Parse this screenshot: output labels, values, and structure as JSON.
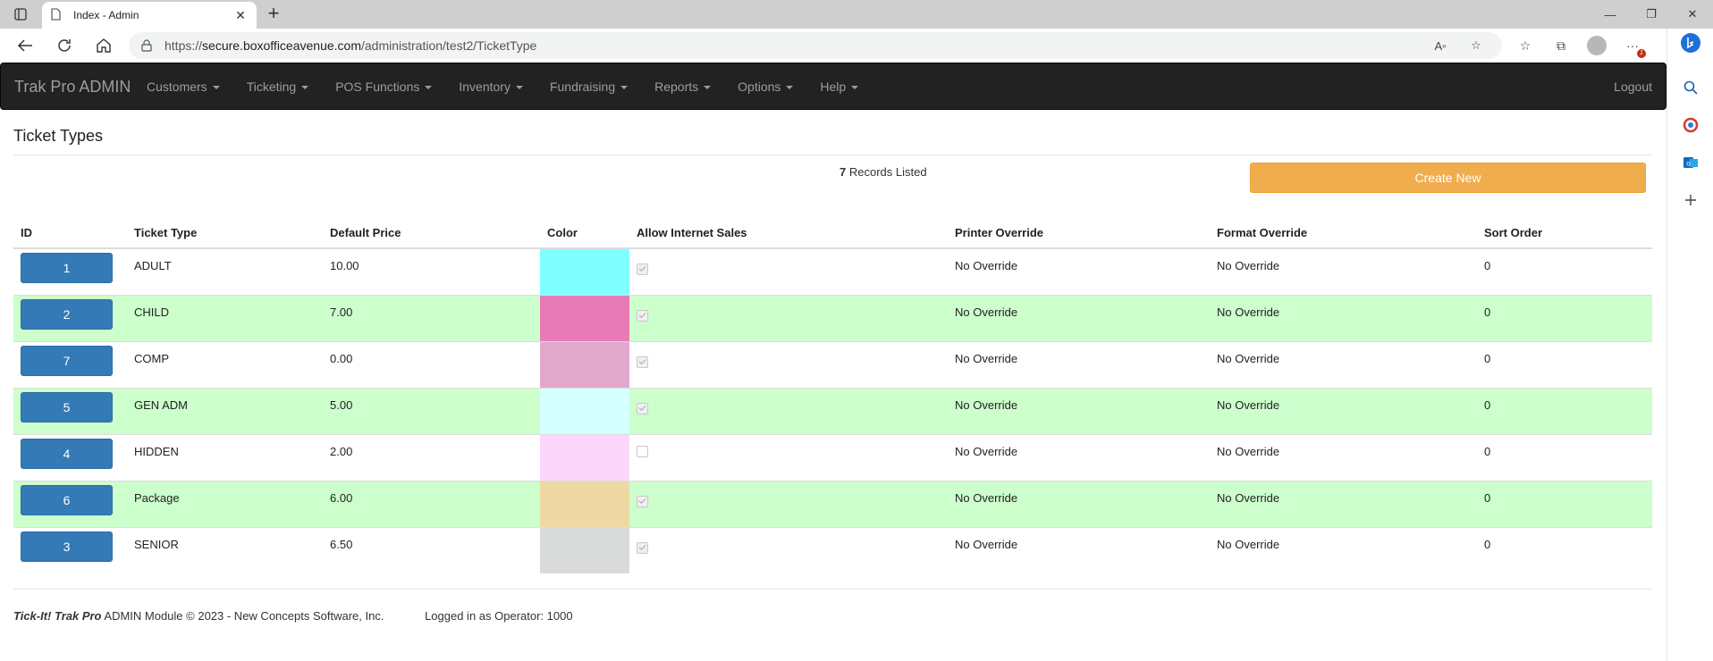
{
  "browser": {
    "tab_title": "Index - Admin",
    "url_scheme": "https://",
    "url_host": "secure.boxofficeavenue.com",
    "url_path": "/administration/test2/TicketType",
    "notification_badge": "1"
  },
  "navbar": {
    "brand": "Trak Pro ADMIN",
    "menu": [
      "Customers",
      "Ticketing",
      "POS Functions",
      "Inventory",
      "Fundraising",
      "Reports",
      "Options",
      "Help"
    ],
    "logout": "Logout"
  },
  "page": {
    "title": "Ticket Types",
    "records_count": "7",
    "records_label": " Records Listed",
    "create_new": "Create New"
  },
  "table": {
    "headers": [
      "ID",
      "Ticket Type",
      "Default Price",
      "Color",
      "Allow Internet Sales",
      "Printer Override",
      "Format Override",
      "Sort Order"
    ],
    "rows": [
      {
        "id": "1",
        "type": "ADULT",
        "price": "10.00",
        "color": "#80ffff",
        "internet": true,
        "printer": "No Override",
        "format": "No Override",
        "sort": "0",
        "highlight": false
      },
      {
        "id": "2",
        "type": "CHILD",
        "price": "7.00",
        "color": "#e87bb5",
        "internet": true,
        "printer": "No Override",
        "format": "No Override",
        "sort": "0",
        "highlight": true
      },
      {
        "id": "7",
        "type": "COMP",
        "price": "0.00",
        "color": "#e1a8cc",
        "internet": true,
        "printer": "No Override",
        "format": "No Override",
        "sort": "0",
        "highlight": false
      },
      {
        "id": "5",
        "type": "GEN ADM",
        "price": "5.00",
        "color": "#d6ffff",
        "internet": true,
        "printer": "No Override",
        "format": "No Override",
        "sort": "0",
        "highlight": true
      },
      {
        "id": "4",
        "type": "HIDDEN",
        "price": "2.00",
        "color": "#fcd6fb",
        "internet": false,
        "printer": "No Override",
        "format": "No Override",
        "sort": "0",
        "highlight": false
      },
      {
        "id": "6",
        "type": "Package",
        "price": "6.00",
        "color": "#eed9a5",
        "internet": true,
        "printer": "No Override",
        "format": "No Override",
        "sort": "0",
        "highlight": true
      },
      {
        "id": "3",
        "type": "SENIOR",
        "price": "6.50",
        "color": "#d9dbdb",
        "internet": true,
        "printer": "No Override",
        "format": "No Override",
        "sort": "0",
        "highlight": false
      }
    ]
  },
  "footer": {
    "product": "Tick-It! Trak Pro",
    "module_text": " ADMIN Module © 2023 - New Concepts Software, Inc.",
    "operator": "Logged in as Operator: 1000"
  }
}
